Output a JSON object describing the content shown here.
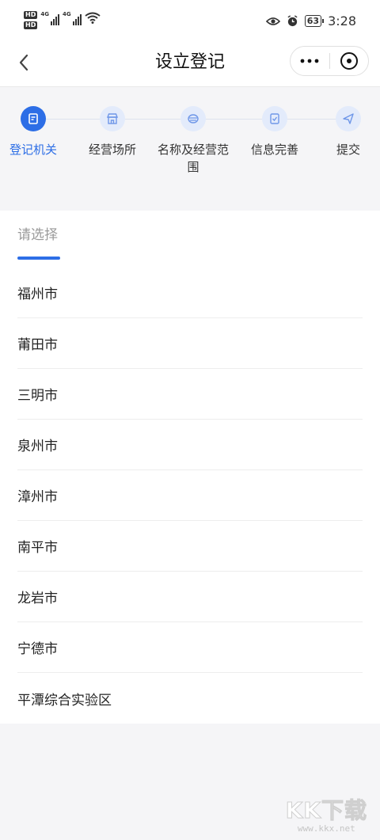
{
  "status_bar": {
    "hd_badge_1": "HD",
    "hd_badge_2": "HD",
    "signal_1": "4G",
    "signal_2": "4G",
    "battery": "63",
    "time": "3:28"
  },
  "nav": {
    "title": "设立登记"
  },
  "steps": [
    {
      "label": "登记机关",
      "active": true
    },
    {
      "label": "经营场所",
      "active": false
    },
    {
      "label": "名称及经营范围",
      "active": false
    },
    {
      "label": "信息完善",
      "active": false
    },
    {
      "label": "提交",
      "active": false
    }
  ],
  "tab": {
    "label": "请选择"
  },
  "cities": [
    "福州市",
    "莆田市",
    "三明市",
    "泉州市",
    "漳州市",
    "南平市",
    "龙岩市",
    "宁德市",
    "平潭综合实验区"
  ],
  "watermark": {
    "main": "KK下载",
    "sub": "www.kkx.net"
  },
  "colors": {
    "accent": "#2d6ee6",
    "step_inactive": "#e3ebfb"
  }
}
